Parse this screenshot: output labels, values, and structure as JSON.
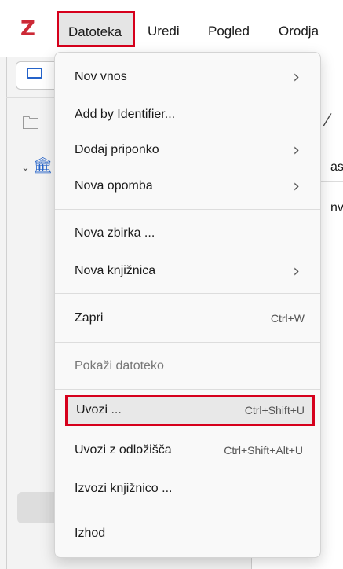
{
  "app": {
    "logo": "Z",
    "menubar": [
      "Datoteka",
      "Uredi",
      "Pogled",
      "Orodja"
    ]
  },
  "background": {
    "column_header": "aslo",
    "row_text": "nve"
  },
  "file_menu": {
    "items": [
      {
        "label": "Nov vnos",
        "submenu": true
      },
      {
        "label": "Add by Identifier...",
        "submenu": false
      },
      {
        "label": "Dodaj priponko",
        "submenu": true
      },
      {
        "label": "Nova opomba",
        "submenu": true
      },
      {
        "label": "Nova zbirka ...",
        "submenu": false
      },
      {
        "label": "Nova knjižnica",
        "submenu": true
      },
      {
        "label": "Zapri",
        "shortcut": "Ctrl+W"
      },
      {
        "label": "Pokaži datoteko",
        "disabled": true
      },
      {
        "label": "Uvozi ...",
        "shortcut": "Ctrl+Shift+U",
        "highlighted": true
      },
      {
        "label": "Uvozi z odložišča",
        "shortcut": "Ctrl+Shift+Alt+U"
      },
      {
        "label": "Izvozi knjižnico ..."
      },
      {
        "label": "Izhod"
      }
    ]
  },
  "colors": {
    "highlight_border": "#d6001c",
    "logo": "#cc2936",
    "accent": "#2563c9"
  }
}
